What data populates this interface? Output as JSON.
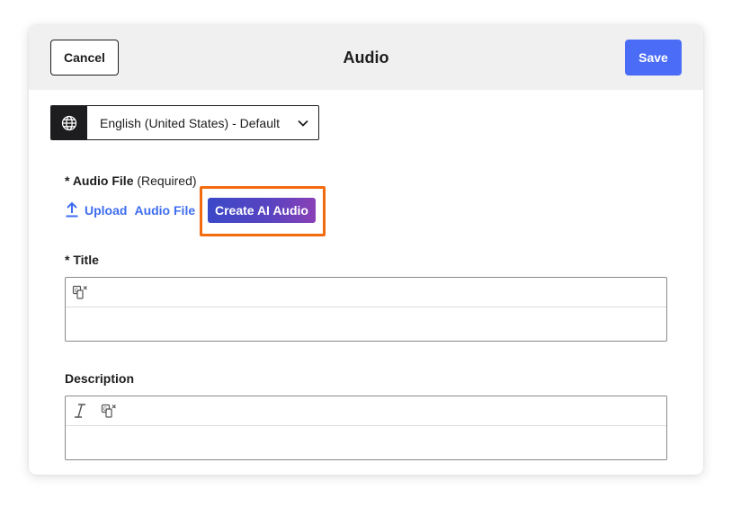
{
  "header": {
    "cancel_label": "Cancel",
    "title": "Audio",
    "save_label": "Save"
  },
  "language": {
    "icon": "globe-icon",
    "selected": "English (United States) - Default"
  },
  "audio_file": {
    "label": "* Audio File",
    "required_note": "(Required)",
    "upload_label": "Upload",
    "upload_suffix": "Audio File",
    "ai_button_label": "Create AI Audio"
  },
  "title_field": {
    "label": "* Title",
    "value": ""
  },
  "description_field": {
    "label": "Description",
    "value": ""
  },
  "colors": {
    "primary": "#4a6cf7",
    "link": "#3f6df0",
    "highlight": "#f26b0f",
    "header_bg": "#f0f0f0"
  }
}
